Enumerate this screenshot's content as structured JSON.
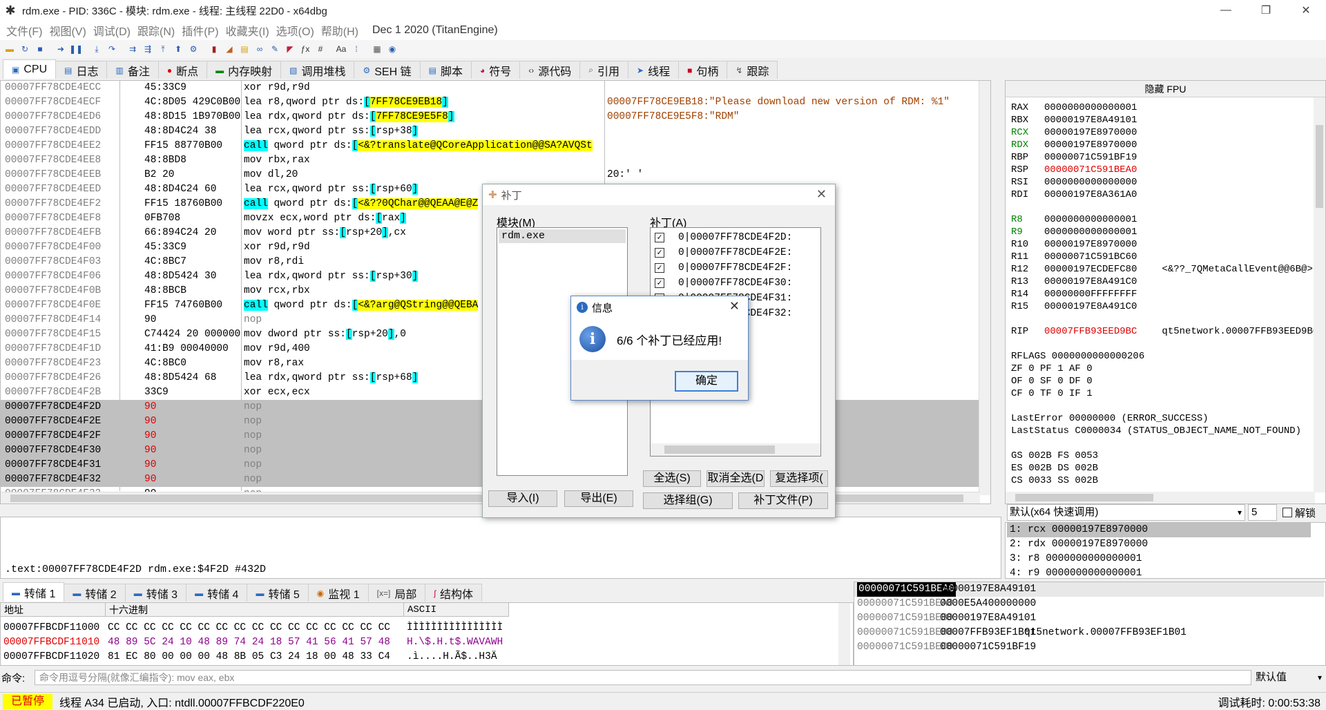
{
  "window": {
    "title": "rdm.exe - PID: 336C - 模块: rdm.exe - 线程: 主线程 22D0 - x64dbg"
  },
  "menu": {
    "items": [
      "文件(F)",
      "视图(V)",
      "调试(D)",
      "跟踪(N)",
      "插件(P)",
      "收藏夹(I)",
      "选项(O)",
      "帮助(H)"
    ],
    "build_date": "Dec 1 2020 (TitanEngine)"
  },
  "tabs": [
    "CPU",
    "日志",
    "备注",
    "断点",
    "内存映射",
    "调用堆栈",
    "SEH 链",
    "脚本",
    "符号",
    "源代码",
    "引用",
    "线程",
    "句柄",
    "跟踪"
  ],
  "disasm": {
    "rows": [
      {
        "addr": "00007FF78CDE4ECC",
        "bytes": "45:33C9",
        "instr": "xor r9d,r9d"
      },
      {
        "addr": "00007FF78CDE4ECF",
        "bytes": "4C:8D05 429C0B00",
        "instr": "lea r8,qword ptr ds:[7FF78CE9EB18]"
      },
      {
        "addr": "00007FF78CDE4ED6",
        "bytes": "48:8D15 1B970B00",
        "instr": "lea rdx,qword ptr ds:[7FF78CE9E5F8]"
      },
      {
        "addr": "00007FF78CDE4EDD",
        "bytes": "48:8D4C24 38",
        "instr": "lea rcx,qword ptr ss:[rsp+38]"
      },
      {
        "addr": "00007FF78CDE4EE2",
        "bytes": "FF15 88770B00",
        "instr": "call qword ptr ds:[<&?translate@QCoreApplication@@SA?AVQSt"
      },
      {
        "addr": "00007FF78CDE4EE8",
        "bytes": "48:8BD8",
        "instr": "mov rbx,rax"
      },
      {
        "addr": "00007FF78CDE4EEB",
        "bytes": "B2 20",
        "instr": "mov dl,20"
      },
      {
        "addr": "00007FF78CDE4EED",
        "bytes": "48:8D4C24 60",
        "instr": "lea rcx,qword ptr ss:[rsp+60]"
      },
      {
        "addr": "00007FF78CDE4EF2",
        "bytes": "FF15 18760B00",
        "instr": "call qword ptr ds:[<&??0QChar@@QEAA@E@Z"
      },
      {
        "addr": "00007FF78CDE4EF8",
        "bytes": "0FB708",
        "instr": "movzx ecx,word ptr ds:[rax]"
      },
      {
        "addr": "00007FF78CDE4EFB",
        "bytes": "66:894C24 20",
        "instr": "mov word ptr ss:[rsp+20],cx"
      },
      {
        "addr": "00007FF78CDE4F00",
        "bytes": "45:33C9",
        "instr": "xor r9d,r9d"
      },
      {
        "addr": "00007FF78CDE4F03",
        "bytes": "4C:8BC7",
        "instr": "mov r8,rdi"
      },
      {
        "addr": "00007FF78CDE4F06",
        "bytes": "48:8D5424 30",
        "instr": "lea rdx,qword ptr ss:[rsp+30]"
      },
      {
        "addr": "00007FF78CDE4F0B",
        "bytes": "48:8BCB",
        "instr": "mov rcx,rbx"
      },
      {
        "addr": "00007FF78CDE4F0E",
        "bytes": "FF15 74760B00",
        "instr": "call qword ptr ds:[<&?arg@QString@@QEBA"
      },
      {
        "addr": "00007FF78CDE4F14",
        "bytes": "90",
        "instr": "nop"
      },
      {
        "addr": "00007FF78CDE4F15",
        "bytes": "C74424 20 000000",
        "instr": "mov dword ptr ss:[rsp+20],0"
      },
      {
        "addr": "00007FF78CDE4F1D",
        "bytes": "41:B9 00040000",
        "instr": "mov r9d,400"
      },
      {
        "addr": "00007FF78CDE4F23",
        "bytes": "4C:8BC0",
        "instr": "mov r8,rax"
      },
      {
        "addr": "00007FF78CDE4F26",
        "bytes": "48:8D5424 68",
        "instr": "lea rdx,qword ptr ss:[rsp+68]"
      },
      {
        "addr": "00007FF78CDE4F2B",
        "bytes": "33C9",
        "instr": "xor ecx,ecx"
      },
      {
        "addr": "00007FF78CDE4F2D",
        "bytes": "90",
        "instr": "nop"
      },
      {
        "addr": "00007FF78CDE4F2E",
        "bytes": "90",
        "instr": "nop"
      },
      {
        "addr": "00007FF78CDE4F2F",
        "bytes": "90",
        "instr": "nop"
      },
      {
        "addr": "00007FF78CDE4F30",
        "bytes": "90",
        "instr": "nop"
      },
      {
        "addr": "00007FF78CDE4F31",
        "bytes": "90",
        "instr": "nop"
      },
      {
        "addr": "00007FF78CDE4F32",
        "bytes": "90",
        "instr": "nop"
      },
      {
        "addr": "00007FF78CDE4F33",
        "bytes": "90",
        "instr": "nop"
      }
    ],
    "comments": [
      {
        "row": 1,
        "text": "00007FF78CE9EB18:\"Please download new version of RDM: %1\""
      },
      {
        "row": 2,
        "text": "00007FF78CE9E5F8:\"RDM\""
      },
      {
        "row": 6,
        "text": "20:' '"
      }
    ]
  },
  "registers": {
    "header": "隐藏 FPU",
    "general": [
      {
        "name": "RAX",
        "value": "0000000000000001"
      },
      {
        "name": "RBX",
        "value": "00000197E8A49101"
      },
      {
        "name": "RCX",
        "value": "00000197E8970000",
        "changed": true
      },
      {
        "name": "RDX",
        "value": "00000197E8970000",
        "changed": true
      },
      {
        "name": "RBP",
        "value": "00000071C591BF19"
      },
      {
        "name": "RSP",
        "value": "00000071C591BEA0",
        "red": true
      },
      {
        "name": "RSI",
        "value": "0000000000000000"
      },
      {
        "name": "RDI",
        "value": "00000197E8A361A0"
      }
    ],
    "extended": [
      {
        "name": "R8",
        "value": "0000000000000001",
        "changed": true
      },
      {
        "name": "R9",
        "value": "0000000000000001",
        "changed": true
      },
      {
        "name": "R10",
        "value": "00000197E8970000"
      },
      {
        "name": "R11",
        "value": "00000071C591BC60"
      },
      {
        "name": "R12",
        "value": "00000197ECDEFC80",
        "comment": "<&??_7QMetaCallEvent@@6B@>"
      },
      {
        "name": "R13",
        "value": "00000197E8A491C0"
      },
      {
        "name": "R14",
        "value": "00000000FFFFFFFF"
      },
      {
        "name": "R15",
        "value": "00000197E8A491C0"
      }
    ],
    "rip": {
      "name": "RIP",
      "value": "00007FFB93EED9BC",
      "comment": "qt5network.00007FFB93EED9BC"
    },
    "rflags": "RFLAGS  0000000000000206",
    "flags": [
      "ZF 0  PF 1  AF 0",
      "OF 0  SF 0  DF 0",
      "CF 0  TF 0  IF 1"
    ],
    "last_error": "LastError  00000000 (ERROR_SUCCESS)",
    "last_status": "LastStatus C0000034 (STATUS_OBJECT_NAME_NOT_FOUND)",
    "segments": [
      "GS 002B  FS 0053",
      "ES 002B  DS 002B",
      "CS 0033  SS 002B"
    ]
  },
  "callconv": {
    "selected": "默认(x64 快速调用)",
    "count": "5",
    "unlock_label": "解锁"
  },
  "args": [
    "1: rcx 00000197E8970000",
    "2: rdx 00000197E8970000",
    "3: r8 0000000000000001",
    "4: r9 0000000000000001"
  ],
  "info": {
    "text": ".text:00007FF78CDE4F2D rdm.exe:$4F2D #432D"
  },
  "dump_tabs": [
    "转储 1",
    "转储 2",
    "转储 3",
    "转储 4",
    "转储 5",
    "监视 1",
    "局部",
    "结构体"
  ],
  "dump": {
    "headers": {
      "addr": "地址",
      "hex": "十六进制",
      "ascii": "ASCII"
    },
    "lines": [
      {
        "addr": "00007FFBCDF11000",
        "hex": "CC CC CC CC  CC CC CC CC  CC CC CC CC  CC CC CC CC",
        "ascii": "ÌÌÌÌÌÌÌÌÌÌÌÌÌÌÌÌ"
      },
      {
        "addr": "00007FFBCDF11010",
        "hex": "48 89 5C 24  10 48 89 74  24 18 57 41  56 41 57 48",
        "ascii": "H.\\$.H.t$.WAVAWH",
        "red": true
      },
      {
        "addr": "00007FFBCDF11020",
        "hex": "81 EC 80 00  00 00 48 8B  05 C3 24 18  00 48 33 C4",
        "ascii": ".ì....H.Ã$..H3Ä"
      }
    ]
  },
  "stack": [
    {
      "addr": "00000071C591BEA0",
      "value": "00000197E8A49101",
      "comment": ""
    },
    {
      "addr": "00000071C591BEA8",
      "value": "0000E5A400000000",
      "comment": ""
    },
    {
      "addr": "00000071C591BEB0",
      "value": "00000197E8A49101",
      "comment": ""
    },
    {
      "addr": "00000071C591BEB8",
      "value": "00007FFB93EF1B01",
      "comment": "qt5network.00007FFB93EF1B01"
    },
    {
      "addr": "00000071C591BEC0",
      "value": "00000071C591BF19",
      "comment": ""
    }
  ],
  "command": {
    "label": "命令:",
    "placeholder": "命令用逗号分隔(就像汇编指令): mov eax, ebx",
    "mode": "默认值"
  },
  "status": {
    "state": "已暂停",
    "message": "线程 A34 已启动, 入口: ntdll.00007FFBCDF220E0",
    "time": "调试耗时:  0:00:53:38"
  },
  "patch_dialog": {
    "title": "补丁",
    "modules_label": "模块(M)",
    "modules": [
      "rdm.exe"
    ],
    "patches_label": "补丁(A)",
    "patches": [
      "0|00007FF78CDE4F2D:",
      "0|00007FF78CDE4F2E:",
      "0|00007FF78CDE4F2F:",
      "0|00007FF78CDE4F30:",
      "0|00007FF78CDE4F31:",
      "0|00007FF78CDE4F32:"
    ],
    "buttons": {
      "select_all": "全选(S)",
      "deselect_all": "取消全选(D",
      "copy_sel": "复选择项(",
      "select_group": "选择组(G)",
      "patch_file": "补丁文件(P)",
      "import": "导入(I)",
      "export": "导出(E)"
    }
  },
  "msgbox": {
    "title": "信息",
    "message": "6/6 个补丁已经应用!",
    "ok": "确定"
  }
}
